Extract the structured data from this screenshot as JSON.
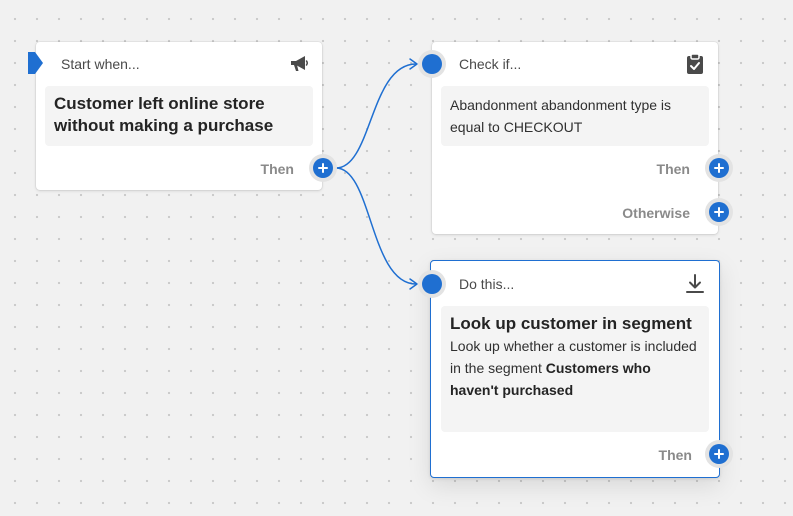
{
  "colors": {
    "accent": "#1f6fd1",
    "canvas": "#f1f1f1",
    "card": "#ffffff",
    "card_body": "#f4f4f4",
    "muted_text": "#8a8a8a"
  },
  "trigger": {
    "header": "Start when...",
    "icon": "megaphone-icon",
    "title": "Customer left online store without making a purchase",
    "then_label": "Then"
  },
  "condition": {
    "header": "Check if...",
    "icon": "clipboard-check-icon",
    "text": "Abandonment abandonment type is equal to CHECKOUT",
    "then_label": "Then",
    "otherwise_label": "Otherwise"
  },
  "action": {
    "header": "Do this...",
    "icon": "download-icon",
    "title": "Look up customer in segment",
    "text_prefix": "Look up whether a customer is included in the segment ",
    "segment_name": "Customers who haven't purchased",
    "then_label": "Then"
  }
}
